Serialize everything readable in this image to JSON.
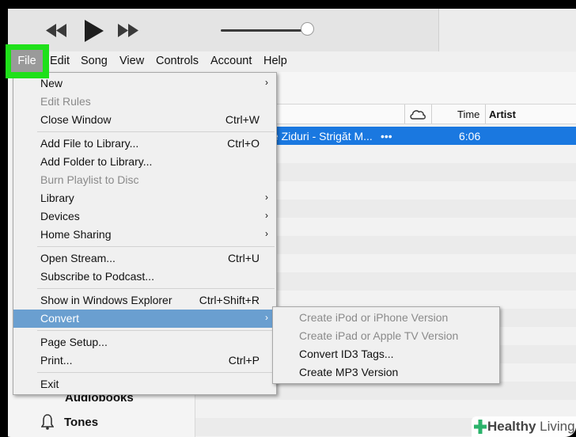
{
  "colors": {
    "highlight": "#1fe01a",
    "selection": "#1a78e0",
    "menu_active": "#6a9fd0"
  },
  "player": {
    "rewind_icon": "rewind-icon",
    "play_icon": "play-icon",
    "forward_icon": "fast-forward-icon",
    "volume_level": 0.92
  },
  "menubar": {
    "items": [
      "File",
      "Edit",
      "Song",
      "View",
      "Controls",
      "Account",
      "Help"
    ]
  },
  "table": {
    "headers": {
      "cloud_icon": "cloud-icon",
      "time": "Time",
      "artist": "Artist"
    },
    "rows": [
      {
        "title": "e Ziduri - Strigăt M...",
        "more": "•••",
        "time": "6:06"
      }
    ]
  },
  "sidebar": {
    "items": [
      "Audiobooks",
      "Tones"
    ]
  },
  "file_menu": {
    "items": [
      {
        "label": "New",
        "submenu": true
      },
      {
        "label": "Edit Rules",
        "disabled": true
      },
      {
        "label": "Close Window",
        "shortcut": "Ctrl+W"
      },
      {
        "label": "Add File to Library...",
        "shortcut": "Ctrl+O"
      },
      {
        "label": "Add Folder to Library..."
      },
      {
        "label": "Burn Playlist to Disc",
        "disabled": true
      },
      {
        "label": "Library",
        "submenu": true
      },
      {
        "label": "Devices",
        "submenu": true
      },
      {
        "label": "Home Sharing",
        "submenu": true
      },
      {
        "label": "Open Stream...",
        "shortcut": "Ctrl+U"
      },
      {
        "label": "Subscribe to Podcast..."
      },
      {
        "label": "Show in Windows Explorer",
        "shortcut": "Ctrl+Shift+R"
      },
      {
        "label": "Convert",
        "submenu": true,
        "active": true
      },
      {
        "label": "Page Setup..."
      },
      {
        "label": "Print...",
        "shortcut": "Ctrl+P"
      },
      {
        "label": "Exit"
      }
    ]
  },
  "convert_menu": {
    "items": [
      {
        "label": "Create iPod or iPhone Version",
        "disabled": true
      },
      {
        "label": "Create iPad or Apple TV Version",
        "disabled": true
      },
      {
        "label": "Convert ID3 Tags..."
      },
      {
        "label": "Create MP3 Version"
      }
    ]
  },
  "watermark": {
    "brand": "Healthy",
    "brand2": "Living"
  }
}
